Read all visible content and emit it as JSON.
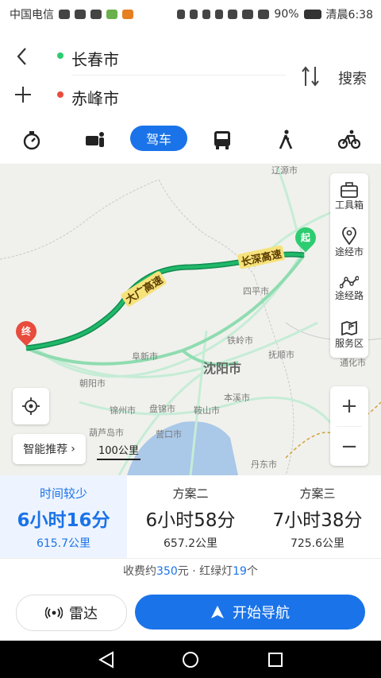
{
  "status": {
    "carrier": "中国电信",
    "battery": "90%",
    "time": "清晨6:38"
  },
  "route": {
    "from": "长春市",
    "to": "赤峰市",
    "search_label": "搜索"
  },
  "modes": {
    "drive_label": "驾车"
  },
  "map": {
    "highway_1": "长深高速",
    "highway_2": "大广高速",
    "start_marker": "起",
    "end_marker": "终",
    "city_main": "沈阳市",
    "labels": [
      "四平市",
      "铁岭市",
      "阜新市",
      "朝阳市",
      "锦州市",
      "盘锦市",
      "鞍山市",
      "本溪市",
      "丹东市",
      "营口市",
      "葫芦岛市",
      "通化市",
      "抚顺市",
      "辽源市"
    ],
    "side_buttons": [
      "工具箱",
      "途经市",
      "途经路",
      "服务区"
    ],
    "smart_label": "智能推荐",
    "scale": "100公里"
  },
  "plans": [
    {
      "tag": "时间较少",
      "time": "6小时16分",
      "dist": "615.7公里"
    },
    {
      "tag": "方案二",
      "time": "6小时58分",
      "dist": "657.2公里"
    },
    {
      "tag": "方案三",
      "time": "7小时38分",
      "dist": "725.6公里"
    }
  ],
  "fee": {
    "prefix": "收费约",
    "amount": "350",
    "mid": "元 · 红绿灯",
    "lights": "19",
    "suffix": "个"
  },
  "actions": {
    "radar": "雷达",
    "navigate": "开始导航"
  },
  "colors": {
    "accent": "#1a73e8",
    "route": "#1fb86a",
    "route_alt": "#8fdcb0"
  }
}
